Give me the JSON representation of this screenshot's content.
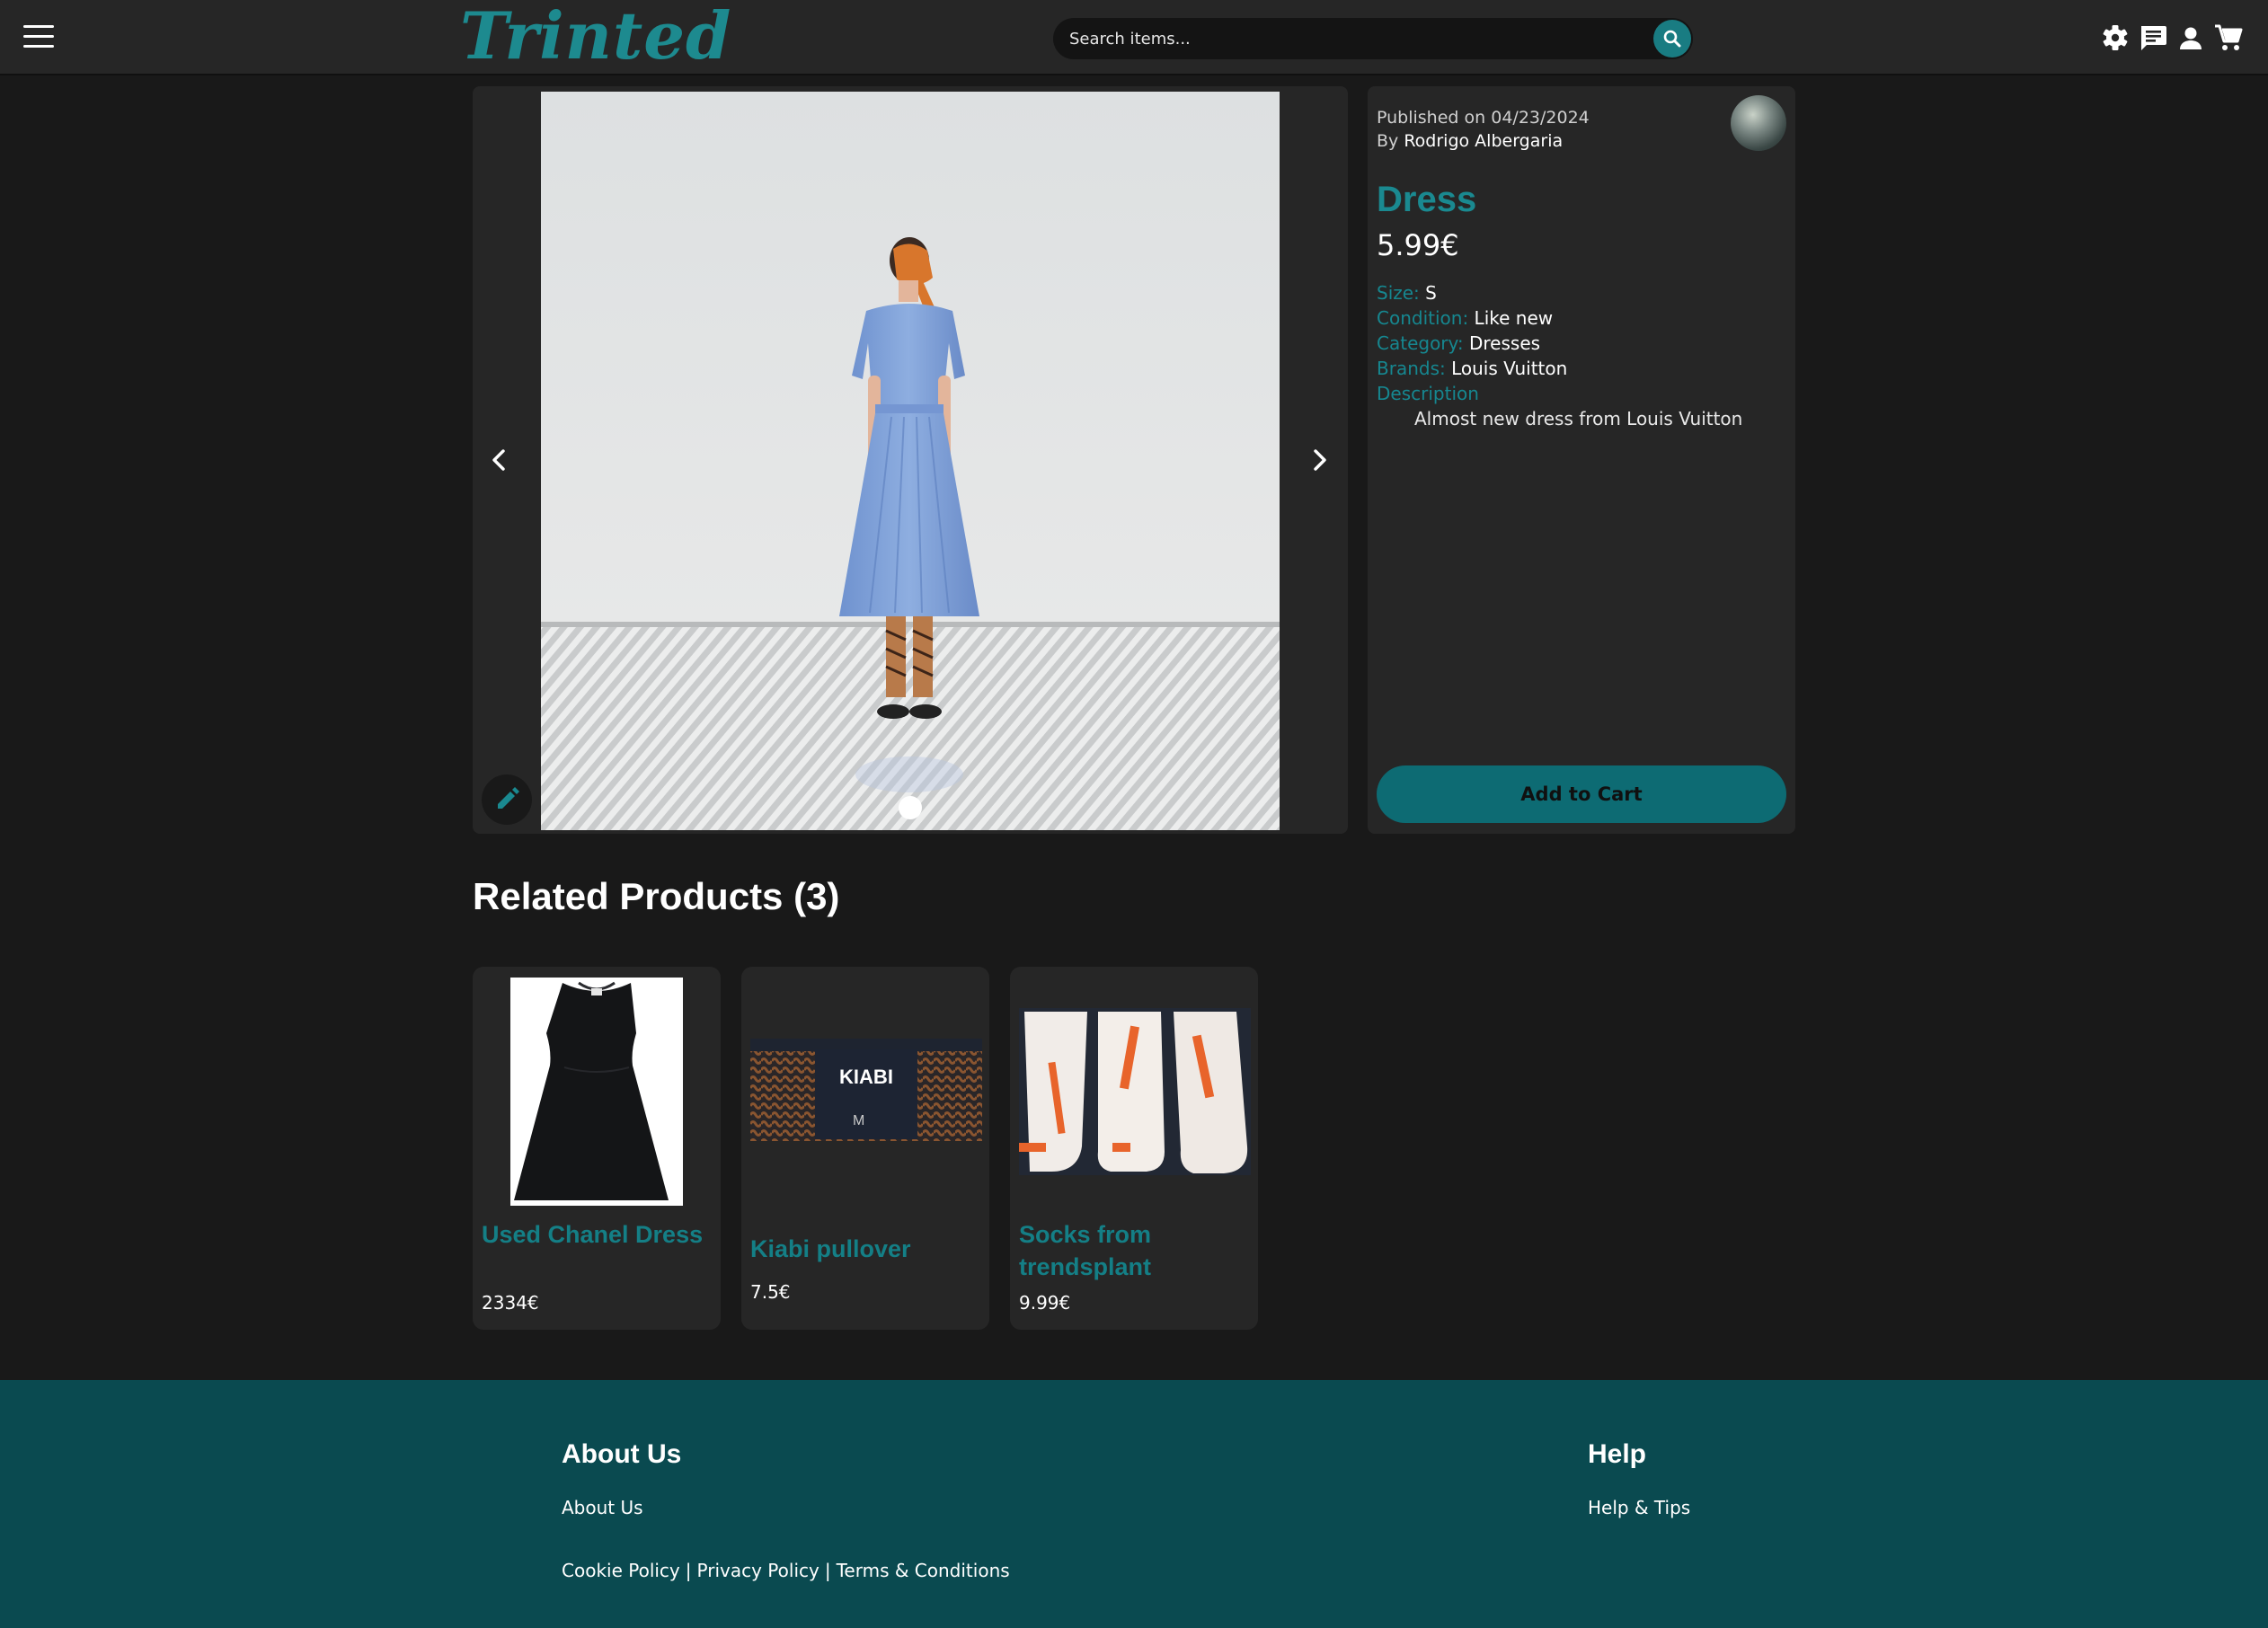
{
  "header": {
    "logo": "Trinted",
    "search": {
      "placeholder": "Search items..."
    },
    "icons": [
      "settings-icon",
      "chat-icon",
      "profile-icon",
      "cart-icon"
    ]
  },
  "product": {
    "published_label": "Published on",
    "published_date": "04/23/2024",
    "by_label": "By",
    "seller": "Rodrigo Albergaria",
    "title": "Dress",
    "price": "5.99€",
    "size_label": "Size:",
    "size": "S",
    "condition_label": "Condition:",
    "condition": "Like new",
    "category_label": "Category:",
    "category": "Dresses",
    "brands_label": "Brands:",
    "brands": "Louis Vuitton",
    "description_label": "Description",
    "description": "Almost new dress from Louis Vuitton",
    "add_to_cart": "Add to Cart"
  },
  "related": {
    "title": "Related Products (3)",
    "items": [
      {
        "name": "Used Chanel Dress",
        "price": "2334€"
      },
      {
        "name": "Kiabi pullover",
        "price": "7.5€",
        "image_label": "KIABI",
        "image_size": "M"
      },
      {
        "name": "Socks from trendsplant",
        "price": "9.99€"
      }
    ]
  },
  "footer": {
    "about_heading": "About Us",
    "about_link": "About Us",
    "help_heading": "Help",
    "help_link": "Help & Tips",
    "cookie": "Cookie Policy",
    "privacy": "Privacy Policy",
    "terms": "Terms & Conditions",
    "separator": "|"
  },
  "colors": {
    "accent": "#1a8990",
    "footer_bg": "#0a4a50",
    "page_bg": "#191919",
    "panel_bg": "#262626"
  }
}
